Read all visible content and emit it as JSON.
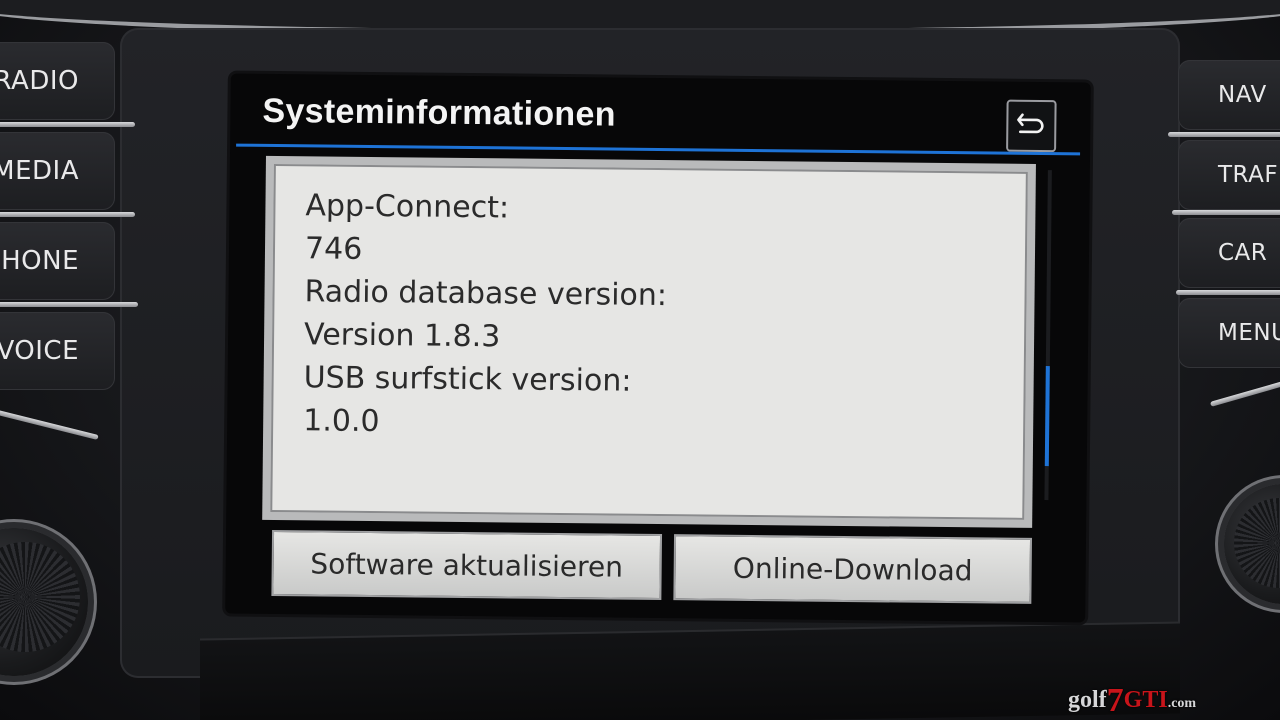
{
  "hardware_buttons": {
    "left": [
      "RADIO",
      "MEDIA",
      "PHONE",
      "VOICE"
    ],
    "right": [
      "NAV",
      "TRAFFIC",
      "CAR",
      "MENU"
    ]
  },
  "screen": {
    "title": "Systeminformationen",
    "back_icon": "back-arrow-icon",
    "accent_color": "#1e73d6",
    "info_lines": [
      "App-Connect:",
      "746",
      "Radio database version:",
      "Version 1.8.3",
      "USB surfstick version:",
      "1.0.0"
    ],
    "scroll_position": 0.85,
    "buttons": {
      "software_update": "Software aktualisieren",
      "online_download": "Online-Download"
    }
  },
  "watermark": {
    "golf": "golf",
    "seven": "7",
    "gti": "GTI",
    "com": ".com"
  }
}
